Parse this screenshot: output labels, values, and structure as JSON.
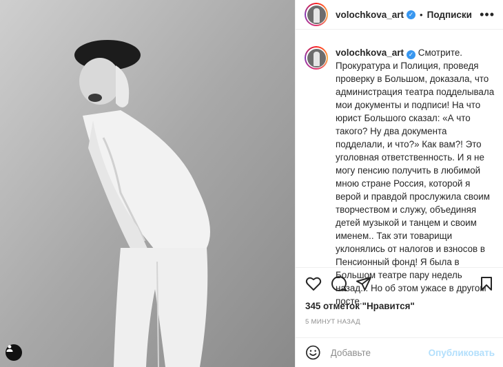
{
  "header": {
    "username": "volochkova_art",
    "separator": "•",
    "follow_label": "Подписки",
    "more_label": "•••"
  },
  "caption": {
    "username": "volochkova_art",
    "text": "Смотрите. Прокуратура и Полиция, проведя проверку в Большом, доказала, что администрация театра подделывала мои документы и подписи! На что юрист Большого сказал: «А что такого? Ну два документа подделали, и что?» Как вам?! Это уголовная ответственность. И я не могу пенсию получить в любимой мною стране Россия, которой я верой и правдой прослужила своим творчеством и служу, объединяя детей музыкой и танцем и своим именем.. Так эти товарищи уклонялись от налогов и взносов в Пенсионный фонд! Я была в Большом театре пару недель назад... Но об этом ужасе в другом посте."
  },
  "icons": {
    "verified": "verified-badge-icon",
    "like": "heart-icon",
    "comment": "comment-icon",
    "share": "paper-plane-icon",
    "save": "bookmark-icon",
    "emoji": "smiley-icon",
    "tag": "user-tag-icon"
  },
  "stats": {
    "likes": "345 отметок \"Нравится\"",
    "time": "5 МИНУТ НАЗАД"
  },
  "comment": {
    "placeholder": "Добавьте",
    "publish_label": "Опубликовать"
  },
  "colors": {
    "verified": "#3897f0",
    "publish_disabled": "#b2dffc",
    "muted": "#8e8e8e"
  }
}
